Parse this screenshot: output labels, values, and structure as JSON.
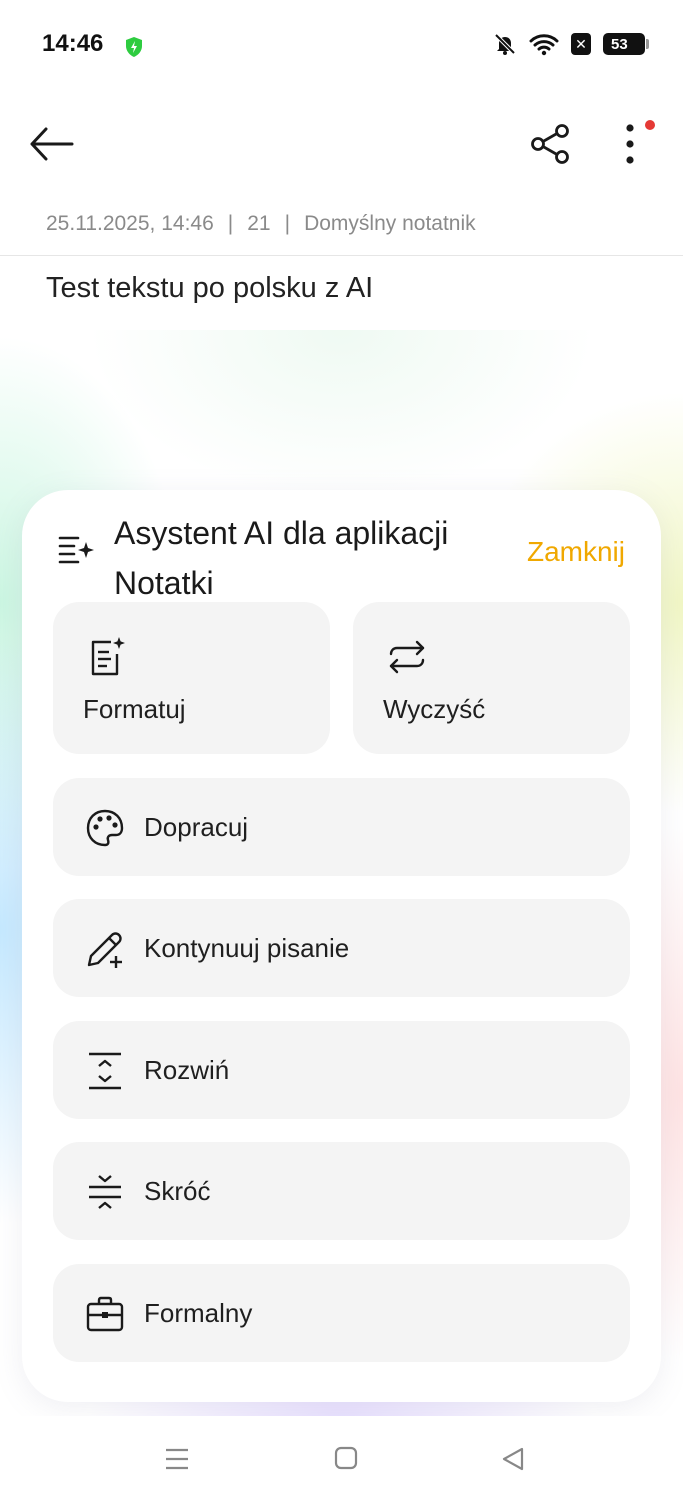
{
  "status_bar": {
    "time": "14:46",
    "battery": "53",
    "icons": [
      "shield-check-icon",
      "bell-off-icon",
      "wifi-icon",
      "close-box-icon",
      "battery-icon"
    ]
  },
  "header": {
    "icons": [
      "back-arrow-icon",
      "share-icon",
      "more-vertical-icon"
    ],
    "notification_dot_color": "#e53935"
  },
  "note": {
    "date": "25.11.2025, 14:46",
    "separator": "|",
    "char_count": "21",
    "notebook": "Domyślny notatnik",
    "body": "Test tekstu po polsku z AI"
  },
  "assistant": {
    "title": "Asystent AI dla aplikacji Notatki",
    "close_label": "Zamknij",
    "accent_color": "#f0a800",
    "tiles": [
      {
        "label": "Formatuj",
        "icon": "format-document-icon"
      },
      {
        "label": "Wyczyść",
        "icon": "clean-swap-icon"
      }
    ],
    "actions": [
      {
        "label": "Dopracuj",
        "icon": "palette-icon"
      },
      {
        "label": "Kontynuuj pisanie",
        "icon": "pencil-plus-icon"
      },
      {
        "label": "Rozwiń",
        "icon": "expand-icon"
      },
      {
        "label": "Skróć",
        "icon": "shorten-icon"
      },
      {
        "label": "Formalny",
        "icon": "briefcase-icon"
      }
    ]
  },
  "navbar": {
    "icons": [
      "menu-icon",
      "home-square-icon",
      "back-triangle-icon"
    ]
  }
}
